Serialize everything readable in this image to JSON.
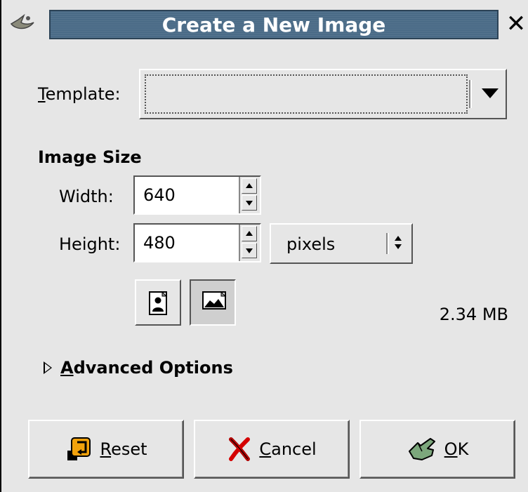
{
  "window": {
    "title": "Create a New Image",
    "close_glyph": "✕"
  },
  "template": {
    "label_first": "T",
    "label_rest": "emplate:",
    "value": ""
  },
  "image_size": {
    "section_title": "Image Size",
    "width_label": "Width:",
    "width_value": "640",
    "height_label": "Height:",
    "height_value": "480",
    "unit": "pixels",
    "orientation_selected": "landscape",
    "memory_size": "2.34 MB"
  },
  "advanced": {
    "first": "A",
    "rest": "dvanced Options",
    "expanded": false
  },
  "buttons": {
    "reset_first": "R",
    "reset_rest": "eset",
    "cancel_first": "C",
    "cancel_rest": "ancel",
    "ok_first": "O",
    "ok_rest": "K"
  },
  "icons": {
    "wm": "gimp-wilber-icon",
    "close": "close-icon",
    "portrait": "portrait-orientation-icon",
    "landscape": "landscape-orientation-icon",
    "reset": "reset-icon",
    "cancel": "cancel-x-icon",
    "ok": "ok-hand-icon"
  },
  "colors": {
    "titlebar": "#4a6b87",
    "background": "#e6e6e6",
    "cancel_red": "#cc0000",
    "ok_green": "#6c9a6c",
    "reset_orange": "#e08a00"
  }
}
